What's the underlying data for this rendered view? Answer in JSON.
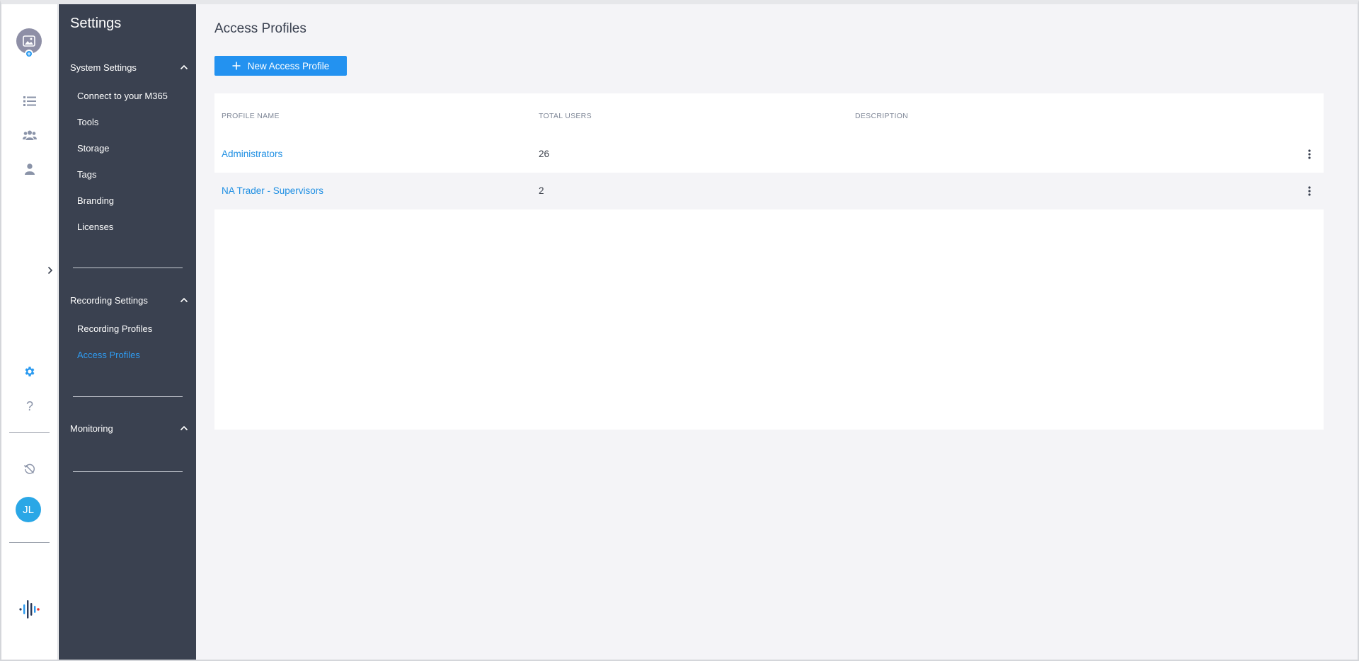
{
  "sidebar": {
    "title": "Settings",
    "sections": [
      {
        "label": "System Settings",
        "items": [
          {
            "label": "Connect to your M365",
            "active": false
          },
          {
            "label": "Tools",
            "active": false
          },
          {
            "label": "Storage",
            "active": false
          },
          {
            "label": "Tags",
            "active": false
          },
          {
            "label": "Branding",
            "active": false
          },
          {
            "label": "Licenses",
            "active": false
          }
        ]
      },
      {
        "label": "Recording Settings",
        "items": [
          {
            "label": "Recording Profiles",
            "active": false
          },
          {
            "label": "Access Profiles",
            "active": true
          }
        ]
      },
      {
        "label": "Monitoring",
        "items": []
      }
    ]
  },
  "rail": {
    "icons": [
      "image-avatar-icon",
      "list-icon",
      "group-icon",
      "person-icon",
      "gear-icon",
      "help-icon",
      "history-icon",
      "logo-icon"
    ],
    "user_initials": "JL",
    "help_glyph": "?",
    "accent_color": "#2a9af0"
  },
  "main": {
    "page_title": "Access Profiles",
    "new_button_label": "New Access Profile",
    "table": {
      "columns": [
        "PROFILE NAME",
        "TOTAL USERS",
        "DESCRIPTION"
      ],
      "rows": [
        {
          "name": "Administrators",
          "total_users": "26",
          "description": ""
        },
        {
          "name": "NA Trader - Supervisors",
          "total_users": "2",
          "description": ""
        }
      ]
    }
  },
  "colors": {
    "sidebar_bg": "#3a4150",
    "accent": "#2392f0",
    "link": "#1f8fe3",
    "page_bg": "#f4f4f7"
  }
}
